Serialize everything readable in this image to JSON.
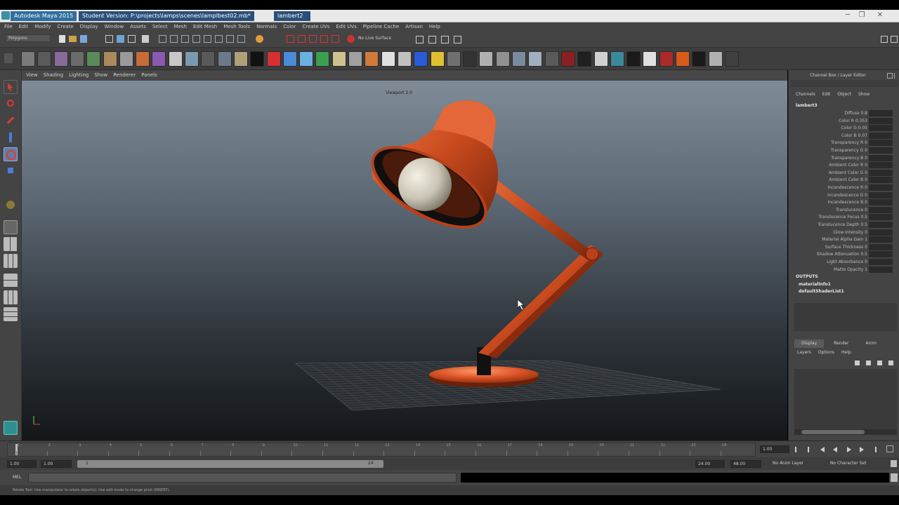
{
  "window": {
    "app_title": "Autodesk Maya 2015",
    "document_tab": "Student Version: P:\\projects\\lamps\\scenes\\lamplbest02.mb*",
    "third_tab": "lambert2",
    "minimize_glyph": "─",
    "restore_glyph": "❐",
    "close_glyph": "✕"
  },
  "menu": [
    "File",
    "Edit",
    "Modify",
    "Create",
    "Display",
    "Window",
    "Assets",
    "Select",
    "Mesh",
    "Edit Mesh",
    "Mesh Tools",
    "Normals",
    "Color",
    "Create UVs",
    "Edit UVs",
    "Pipeline Cache",
    "Artisan",
    "Help"
  ],
  "status_line": {
    "mode": "Polygons",
    "live_surface": "No Live Surface"
  },
  "viewport": {
    "panel_menu": [
      "View",
      "Shading",
      "Lighting",
      "Show",
      "Renderer",
      "Panels"
    ],
    "camera_label": "Viewport 2.0"
  },
  "channel_box": {
    "title": "Channel Box / Layer Editor",
    "menu": [
      "Channels",
      "Edit",
      "Object",
      "Show"
    ],
    "node_name": "lambert3",
    "attributes": [
      "Diffuse 0.8",
      "Color R 0.353",
      "Color G 0.05",
      "Color B 0.07",
      "Transparency R 0",
      "Transparency G 0",
      "Transparency B 0",
      "Ambient Color R 0",
      "Ambient Color G 0",
      "Ambient Color B 0",
      "Incandescence R 0",
      "Incandescence G 0",
      "Incandescence B 0",
      "Translucence 0",
      "Translucence Focus 0.5",
      "Translucence Depth 0.5",
      "Glow Intensity 0",
      "Material Alpha Gain 1",
      "Surface Thickness 0",
      "Shadow Attenuation 0.5",
      "Light Absorbance 0",
      "Matte Opacity 1"
    ],
    "outputs_header": "OUTPUTS",
    "outputs": [
      "materialInfo1",
      "defaultShaderList1"
    ]
  },
  "layer_editor": {
    "tabs": [
      "Display",
      "Render",
      "Anim"
    ],
    "menu": [
      "Layers",
      "Options",
      "Help"
    ]
  },
  "time_slider": {
    "ticks": [
      "1",
      "2",
      "3",
      "4",
      "5",
      "6",
      "7",
      "8",
      "9",
      "10",
      "11",
      "12",
      "13",
      "14",
      "15",
      "16",
      "17",
      "18",
      "19",
      "20",
      "21",
      "22",
      "23",
      "24"
    ],
    "current_frame": "1.00"
  },
  "range_slider": {
    "start_time": "1.00",
    "playback_start": "1.00",
    "range_start_label": "1",
    "range_end_label": "24",
    "playback_end": "24.00",
    "end_time": "48.00",
    "anim_layer": "No Anim Layer",
    "character_set": "No Character Set"
  },
  "command_line": {
    "label": "MEL"
  },
  "help_line": "Rotate Tool: Use manipulator to rotate object(s). Use edit mode to change pivot (INSERT)."
}
